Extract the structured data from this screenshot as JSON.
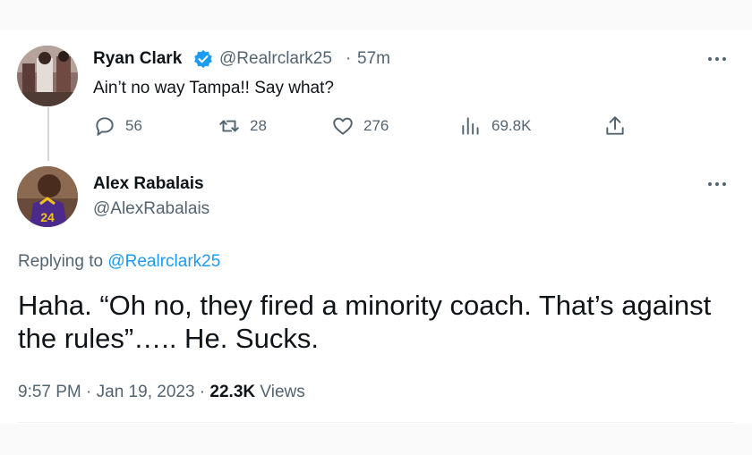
{
  "tweet1": {
    "name": "Ryan Clark",
    "handle": "@Realrclark25",
    "separator": "·",
    "time": "57m",
    "text": "Ain’t no way Tampa!! Say what?",
    "verified_color": "#1d9bf0",
    "actions": {
      "replies": "56",
      "retweets": "28",
      "likes": "276",
      "views": "69.8K"
    },
    "more_icon": "more-icon"
  },
  "tweet2": {
    "name": "Alex Rabalais",
    "handle": "@AlexRabalais",
    "replying_prefix": "Replying to",
    "replying_mention": "@Realrclark25",
    "text": "Haha. “Oh no, they fired a minority coach.  That’s against the rules”….. He. Sucks.",
    "timestamp": "9:57 PM · Jan 19, 2023 ·",
    "views_count": "22.3K",
    "views_label": "Views",
    "more_icon": "more-icon"
  },
  "colors": {
    "text": "#0f1419",
    "secondary": "#536471",
    "accent": "#1d9bf0"
  }
}
